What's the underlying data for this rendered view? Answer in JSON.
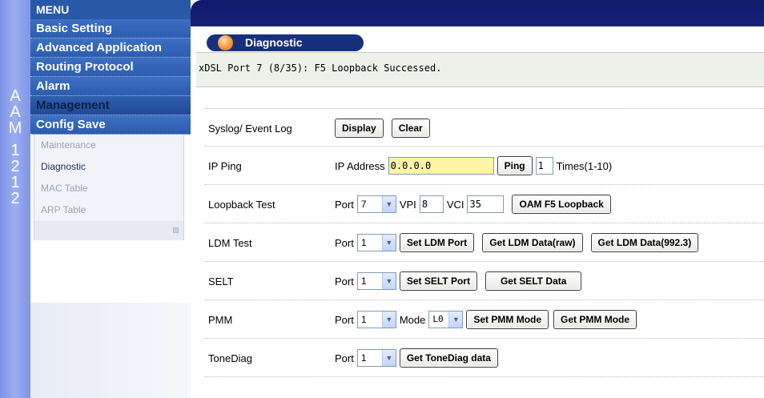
{
  "sidebar": {
    "vertical_label": [
      "A",
      "A",
      "M",
      "1",
      "2",
      "1",
      "2"
    ],
    "menu_title": "MENU",
    "items": [
      {
        "label": "Basic Setting"
      },
      {
        "label": "Advanced Application"
      },
      {
        "label": "Routing Protocol"
      },
      {
        "label": "Alarm"
      },
      {
        "label": "Management"
      },
      {
        "label": "Config Save"
      }
    ],
    "subitems": [
      {
        "label": "Maintenance"
      },
      {
        "label": "Diagnostic"
      },
      {
        "label": "MAC Table"
      },
      {
        "label": "ARP Table"
      }
    ]
  },
  "page": {
    "title": "Diagnostic",
    "message": "xDSL Port 7 (8/35): F5 Loopback Successed."
  },
  "rows": {
    "syslog": {
      "label": "Syslog/ Event Log",
      "display_btn": "Display",
      "clear_btn": "Clear"
    },
    "ping": {
      "label": "IP  Ping",
      "ip_label": "IP Address",
      "ip_value": "0.0.0.0",
      "ping_btn": "Ping",
      "times_value": "1",
      "times_label": "Times(1-10)"
    },
    "loopback": {
      "label": "Loopback Test",
      "port_label": "Port",
      "port_value": "7",
      "vpi_label": "VPI",
      "vpi_value": "8",
      "vci_label": "VCI",
      "vci_value": "35",
      "btn": "OAM F5 Loopback"
    },
    "ldm": {
      "label": "LDM Test",
      "port_label": "Port",
      "port_value": "1",
      "set_btn": "Set LDM Port",
      "raw_btn": "Get LDM Data(raw)",
      "std_btn": "Get LDM Data(992.3)"
    },
    "selt": {
      "label": "SELT",
      "port_label": "Port",
      "port_value": "1",
      "set_btn": "Set SELT Port",
      "get_btn": "Get SELT Data"
    },
    "pmm": {
      "label": "PMM",
      "port_label": "Port",
      "port_value": "1",
      "mode_label": "Mode",
      "mode_value": "L0",
      "set_btn": "Set PMM Mode",
      "get_btn": "Get PMM Mode"
    },
    "tone": {
      "label": "ToneDiag",
      "port_label": "Port",
      "port_value": "1",
      "get_btn": "Get ToneDiag data"
    }
  },
  "icons": {
    "dropdown": "chevron-down-icon",
    "title_orb": "orb-icon"
  }
}
